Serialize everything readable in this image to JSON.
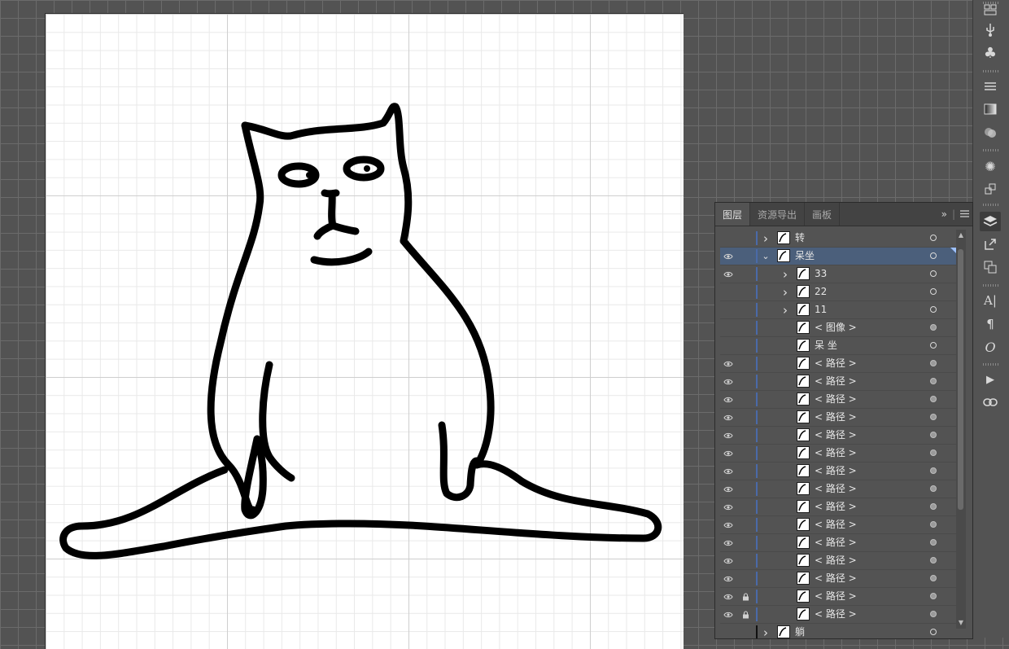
{
  "panel": {
    "tabs": [
      "图层",
      "资源导出",
      "画板"
    ],
    "active_tab": 0,
    "menu_expand": "»",
    "menu_icon": "hamburger-menu-icon"
  },
  "layers": [
    {
      "label": "转",
      "indent": 0,
      "expander": "collapsed",
      "visible": false,
      "locked": false,
      "target": "open",
      "color": "#4a6aa8"
    },
    {
      "label": "呆坐",
      "indent": 0,
      "expander": "expanded",
      "visible": true,
      "locked": false,
      "target": "open",
      "selected": true,
      "color": "#4a6aa8"
    },
    {
      "label": "33",
      "indent": 1,
      "expander": "collapsed",
      "visible": true,
      "locked": false,
      "target": "open"
    },
    {
      "label": "22",
      "indent": 1,
      "expander": "collapsed",
      "visible": false,
      "locked": false,
      "target": "open"
    },
    {
      "label": "11",
      "indent": 1,
      "expander": "collapsed",
      "visible": false,
      "locked": false,
      "target": "open"
    },
    {
      "label": "< 图像 >",
      "indent": 1,
      "expander": "none",
      "visible": false,
      "locked": false,
      "target": "filled"
    },
    {
      "label": "呆 坐",
      "indent": 1,
      "expander": "none",
      "visible": false,
      "locked": false,
      "target": "open"
    },
    {
      "label": "< 路径 >",
      "indent": 1,
      "expander": "none",
      "visible": true,
      "locked": false,
      "target": "filled"
    },
    {
      "label": "< 路径 >",
      "indent": 1,
      "expander": "none",
      "visible": true,
      "locked": false,
      "target": "filled"
    },
    {
      "label": "< 路径 >",
      "indent": 1,
      "expander": "none",
      "visible": true,
      "locked": false,
      "target": "filled"
    },
    {
      "label": "< 路径 >",
      "indent": 1,
      "expander": "none",
      "visible": true,
      "locked": false,
      "target": "filled"
    },
    {
      "label": "< 路径 >",
      "indent": 1,
      "expander": "none",
      "visible": true,
      "locked": false,
      "target": "filled"
    },
    {
      "label": "< 路径 >",
      "indent": 1,
      "expander": "none",
      "visible": true,
      "locked": false,
      "target": "filled"
    },
    {
      "label": "< 路径 >",
      "indent": 1,
      "expander": "none",
      "visible": true,
      "locked": false,
      "target": "filled"
    },
    {
      "label": "< 路径 >",
      "indent": 1,
      "expander": "none",
      "visible": true,
      "locked": false,
      "target": "filled"
    },
    {
      "label": "< 路径 >",
      "indent": 1,
      "expander": "none",
      "visible": true,
      "locked": false,
      "target": "filled"
    },
    {
      "label": "< 路径 >",
      "indent": 1,
      "expander": "none",
      "visible": true,
      "locked": false,
      "target": "filled"
    },
    {
      "label": "< 路径 >",
      "indent": 1,
      "expander": "none",
      "visible": true,
      "locked": false,
      "target": "filled"
    },
    {
      "label": "< 路径 >",
      "indent": 1,
      "expander": "none",
      "visible": true,
      "locked": false,
      "target": "filled"
    },
    {
      "label": "< 路径 >",
      "indent": 1,
      "expander": "none",
      "visible": true,
      "locked": false,
      "target": "filled"
    },
    {
      "label": "< 路径 >",
      "indent": 1,
      "expander": "none",
      "visible": true,
      "locked": true,
      "target": "filled"
    },
    {
      "label": "< 路径 >",
      "indent": 1,
      "expander": "none",
      "visible": true,
      "locked": true,
      "target": "filled"
    },
    {
      "label": "躺",
      "indent": 0,
      "expander": "collapsed",
      "visible": false,
      "locked": false,
      "target": "open",
      "color": "#111111"
    }
  ],
  "tool_strip": [
    "libraries-icon",
    "usb-symbols-icon",
    "club-icon",
    "stroke-lines-icon",
    "gradient-icon",
    "transparency-icon",
    "appearance-sun-icon",
    "asset-export-icon",
    "layers-icon",
    "export-icon",
    "artboards-icon",
    "character-icon",
    "paragraph-icon",
    "opentype-icon",
    "actions-play-icon",
    "links-icon"
  ],
  "colors": {
    "selection": "#4b5f7b",
    "layer_color": "#4a6aa8"
  }
}
